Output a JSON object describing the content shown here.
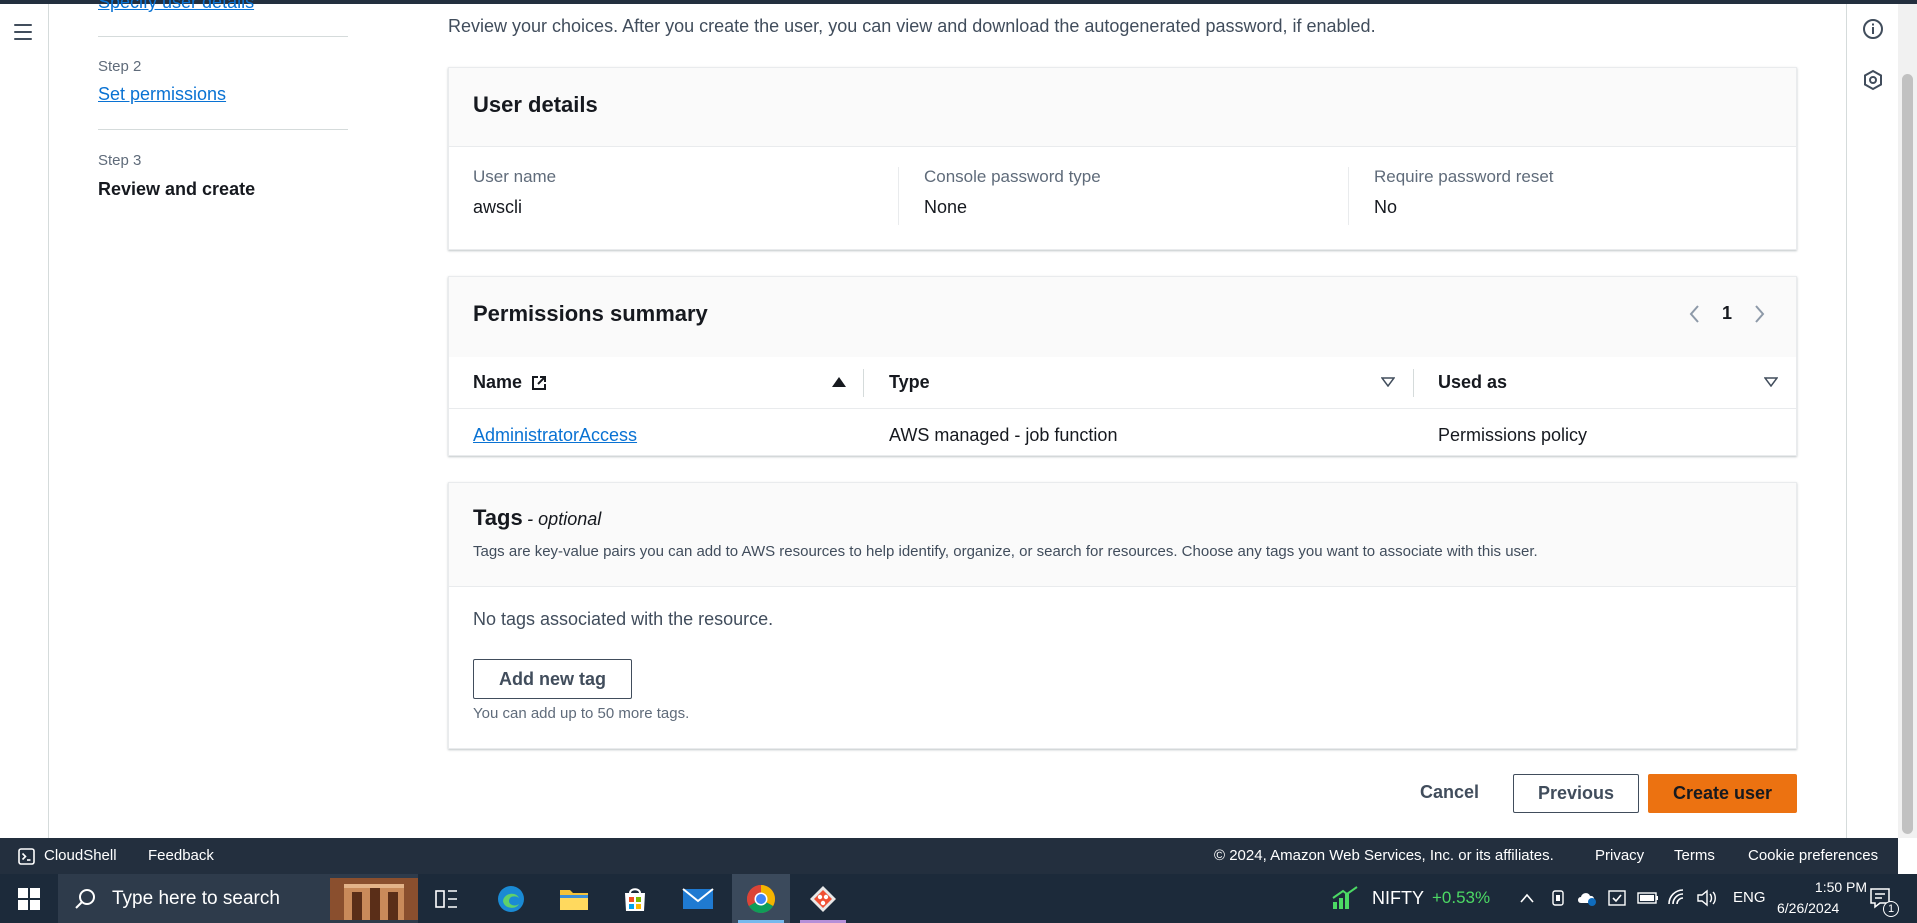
{
  "steps": {
    "step1_link": "Specify user details",
    "step2_label": "Step 2",
    "step2_link": "Set permissions",
    "step3_label": "Step 3",
    "step3_current": "Review and create"
  },
  "intro": "Review your choices. After you create the user, you can view and download the autogenerated password, if enabled.",
  "user_details": {
    "title": "User details",
    "fields": [
      {
        "key": "User name",
        "value": "awscli"
      },
      {
        "key": "Console password type",
        "value": "None"
      },
      {
        "key": "Require password reset",
        "value": "No"
      }
    ]
  },
  "permissions": {
    "title": "Permissions summary",
    "page": "1",
    "columns": [
      "Name",
      "Type",
      "Used as"
    ],
    "rows": [
      {
        "name": "AdministratorAccess",
        "type": "AWS managed - job function",
        "used_as": "Permissions policy"
      }
    ]
  },
  "tags": {
    "title": "Tags",
    "optional": "- optional",
    "description": "Tags are key-value pairs you can add to AWS resources to help identify, organize, or search for resources. Choose any tags you want to associate with this user.",
    "empty": "No tags associated with the resource.",
    "add_button": "Add new tag",
    "hint": "You can add up to 50 more tags."
  },
  "actions": {
    "cancel": "Cancel",
    "previous": "Previous",
    "create": "Create user"
  },
  "footer": {
    "cloudshell": "CloudShell",
    "feedback": "Feedback",
    "copyright": "© 2024, Amazon Web Services, Inc. or its affiliates.",
    "privacy": "Privacy",
    "terms": "Terms",
    "cookies": "Cookie preferences"
  },
  "taskbar": {
    "search_placeholder": "Type here to search",
    "stock_name": "NIFTY",
    "stock_change": "+0.53%",
    "language": "ENG",
    "time": "1:50 PM",
    "date": "6/26/2024",
    "notification_count": "1"
  },
  "colors": {
    "link": "#0972d3",
    "primary": "#ec7211",
    "footer_bg": "#232f3e",
    "stock_up": "#4cd964"
  }
}
